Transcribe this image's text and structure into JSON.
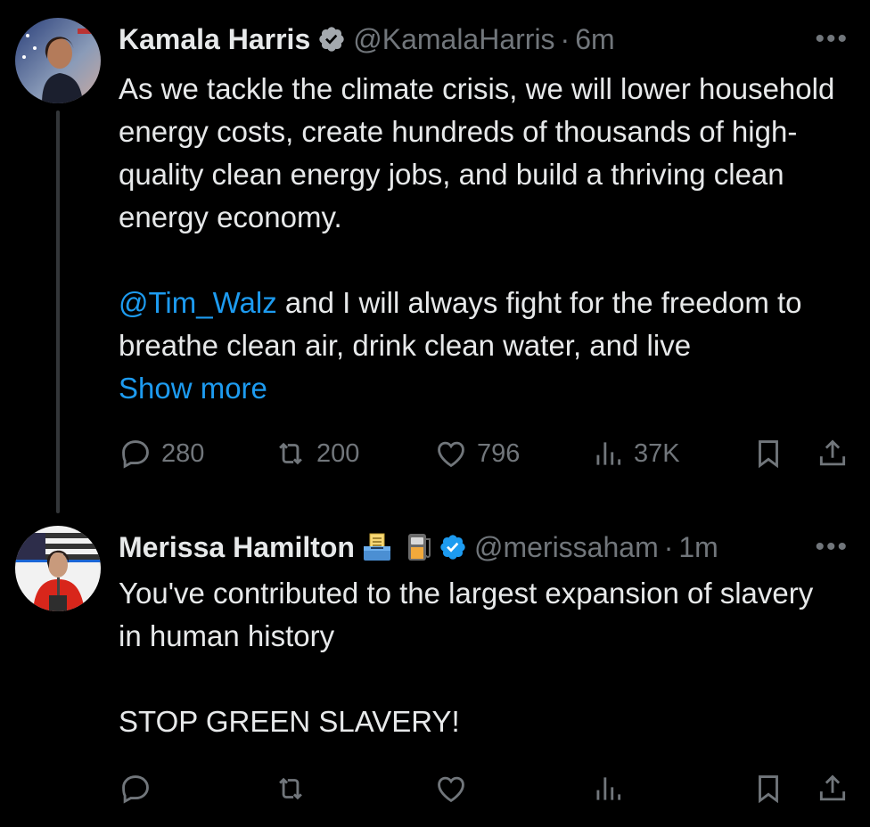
{
  "tweets": [
    {
      "author_name": "Kamala Harris",
      "handle": "@KamalaHarris",
      "separator": "·",
      "time": "6m",
      "more": "•••",
      "paragraph1": "As we tackle the climate crisis, we will lower household energy costs, create hundreds of thousands of high-quality clean energy jobs, and build a thriving clean energy economy.",
      "mention": "@Tim_Walz",
      "paragraph2_rest": " and I will always fight for the freedom to breathe clean air, drink clean water, and live",
      "show_more": "Show more",
      "replies": "280",
      "reposts": "200",
      "likes": "796",
      "views": "37K"
    },
    {
      "author_name": "Merissa Hamilton",
      "handle": "@merissaham",
      "separator": "·",
      "time": "1m",
      "more": "•••",
      "paragraph1": "You've contributed to the largest expansion of slavery in human history",
      "paragraph2": "STOP GREEN SLAVERY!"
    }
  ],
  "colors": {
    "background": "#000000",
    "text": "#e7e9ea",
    "muted": "#71767b",
    "link": "#1d9bf0",
    "verified": "#1d9bf0"
  },
  "icons": {
    "reply": "reply-icon",
    "repost": "repost-icon",
    "like": "heart-icon",
    "views": "views-icon",
    "bookmark": "bookmark-icon",
    "share": "share-icon",
    "verified": "verified-badge-icon",
    "ballot": "ballot-box-emoji-icon",
    "fuel": "fuel-pump-emoji-icon"
  }
}
